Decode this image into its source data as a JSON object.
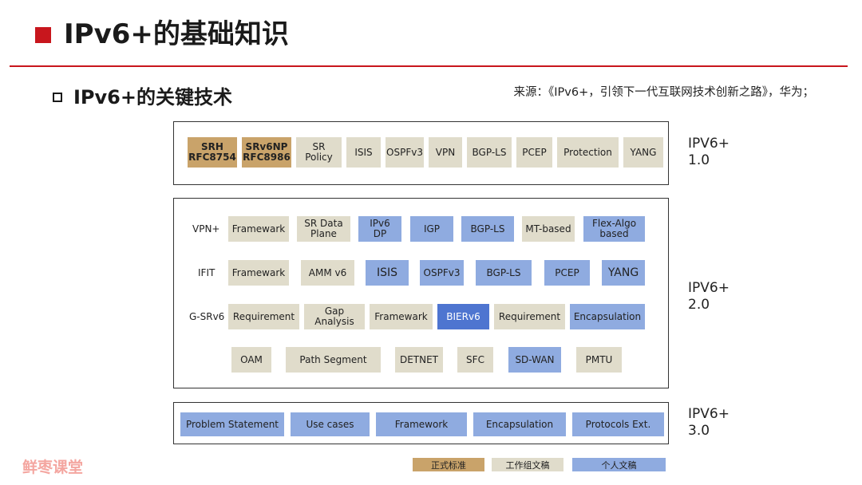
{
  "header": {
    "title": "IPv6+的基础知识"
  },
  "section": {
    "subtitle": "IPv6+的关键技术",
    "source": "来源：《IPv6+，引领下一代互联网技术创新之路》，华为；"
  },
  "colors": {
    "accent": "#c8161d",
    "formal": "#c9a36a",
    "working_group": "#e0dccb",
    "individual": "#8fabe0",
    "highlight": "#4e75d0"
  },
  "gen1": {
    "label": "IPV6+\n1.0",
    "items": [
      {
        "label": "SRH\nRFC8754",
        "type": "formal"
      },
      {
        "label": "SRv6NP\nRFC8986",
        "type": "formal"
      },
      {
        "label": "SR\nPolicy",
        "type": "wg"
      },
      {
        "label": "ISIS",
        "type": "wg"
      },
      {
        "label": "OSPFv3",
        "type": "wg"
      },
      {
        "label": "VPN",
        "type": "wg"
      },
      {
        "label": "BGP-LS",
        "type": "wg"
      },
      {
        "label": "PCEP",
        "type": "wg"
      },
      {
        "label": "Protection",
        "type": "wg"
      },
      {
        "label": "YANG",
        "type": "wg"
      }
    ]
  },
  "gen2": {
    "label": "IPV6+\n2.0",
    "rows": [
      {
        "label": "VPN+",
        "items": [
          {
            "label": "Framewark",
            "type": "wg"
          },
          {
            "label": "SR Data\nPlane",
            "type": "wg"
          },
          {
            "label": "IPv6\nDP",
            "type": "ind"
          },
          {
            "label": "IGP",
            "type": "ind"
          },
          {
            "label": "BGP-LS",
            "type": "ind"
          },
          {
            "label": "MT-based",
            "type": "wg"
          },
          {
            "label": "Flex-Algo\nbased",
            "type": "ind"
          }
        ]
      },
      {
        "label": "IFIT",
        "items": [
          {
            "label": "Framewark",
            "type": "wg"
          },
          {
            "label": "AMM v6",
            "type": "wg"
          },
          {
            "label": "ISIS",
            "type": "ind"
          },
          {
            "label": "OSPFv3",
            "type": "ind"
          },
          {
            "label": "BGP-LS",
            "type": "ind"
          },
          {
            "label": "PCEP",
            "type": "ind"
          },
          {
            "label": "YANG",
            "type": "ind"
          }
        ]
      },
      {
        "label": "G-SRv6",
        "items": [
          {
            "label": "Requirement",
            "type": "wg"
          },
          {
            "label": "Gap\nAnalysis",
            "type": "wg"
          },
          {
            "label": "Framewark",
            "type": "wg"
          },
          {
            "label": "BIERv6",
            "type": "hl"
          },
          {
            "label": "Requirement",
            "type": "wg"
          },
          {
            "label": "Encapsulation",
            "type": "ind"
          }
        ]
      },
      {
        "label": "",
        "items": [
          {
            "label": "OAM",
            "type": "wg"
          },
          {
            "label": "Path Segment",
            "type": "wg"
          },
          {
            "label": "DETNET",
            "type": "wg"
          },
          {
            "label": "SFC",
            "type": "wg"
          },
          {
            "label": "SD-WAN",
            "type": "ind"
          },
          {
            "label": "PMTU",
            "type": "wg"
          }
        ]
      }
    ]
  },
  "gen3": {
    "label": "IPV6+\n3.0",
    "items": [
      {
        "label": "Problem Statement",
        "type": "ind"
      },
      {
        "label": "Use cases",
        "type": "ind"
      },
      {
        "label": "Framework",
        "type": "ind"
      },
      {
        "label": "Encapsulation",
        "type": "ind"
      },
      {
        "label": "Protocols Ext.",
        "type": "ind"
      }
    ]
  },
  "legend": [
    {
      "label": "正式标准",
      "type": "formal"
    },
    {
      "label": "工作组文稿",
      "type": "wg"
    },
    {
      "label": "个人文稿",
      "type": "ind"
    }
  ],
  "watermark": "鲜枣课堂"
}
